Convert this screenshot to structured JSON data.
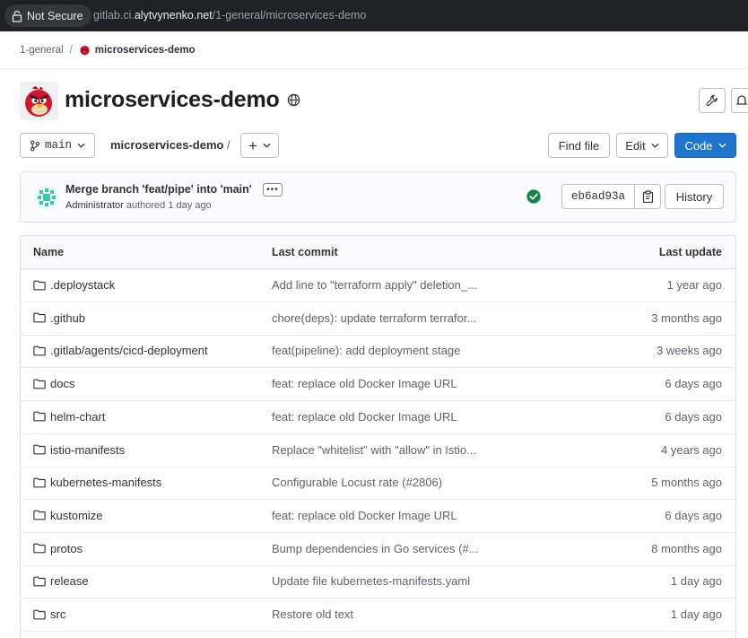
{
  "browser": {
    "security_label": "Not Secure",
    "url_prefix": "gitlab.ci.",
    "url_host": "alytvynenko.net",
    "url_path": "/1-general/microservices-demo"
  },
  "breadcrumb": {
    "group": "1-general",
    "separator": "/",
    "project": "microservices-demo"
  },
  "project": {
    "title": "microservices-demo",
    "visibility_icon": "globe-icon"
  },
  "toolbar": {
    "branch": "main",
    "path": "microservices-demo",
    "path_separator": "/",
    "add_label": "+",
    "find_file_label": "Find file",
    "edit_label": "Edit",
    "code_label": "Code"
  },
  "commit": {
    "title": "Merge branch 'feat/pipe' into 'main'",
    "author": "Administrator",
    "authored_text": "authored",
    "time": "1 day ago",
    "sha": "eb6ad93a",
    "history_label": "History",
    "ellipsis": "•••"
  },
  "table": {
    "headers": [
      "Name",
      "Last commit",
      "Last update"
    ],
    "rows": [
      {
        "name": ".deploystack",
        "commit": "Add line to \"terraform apply\" deletion_...",
        "updated": "1 year ago"
      },
      {
        "name": ".github",
        "commit": "chore(deps): update terraform terrafor...",
        "updated": "3 months ago"
      },
      {
        "name": ".gitlab/agents/cicd-deployment",
        "commit": "feat(pipeline): add deployment stage",
        "updated": "3 weeks ago"
      },
      {
        "name": "docs",
        "commit": "feat: replace old Docker Image URL",
        "updated": "6 days ago"
      },
      {
        "name": "helm-chart",
        "commit": "feat: replace old Docker Image URL",
        "updated": "6 days ago"
      },
      {
        "name": "istio-manifests",
        "commit": "Replace \"whitelist\" with \"allow\" in Istio...",
        "updated": "4 years ago"
      },
      {
        "name": "kubernetes-manifests",
        "commit": "Configurable Locust rate (#2806)",
        "updated": "5 months ago"
      },
      {
        "name": "kustomize",
        "commit": "feat: replace old Docker Image URL",
        "updated": "6 days ago"
      },
      {
        "name": "protos",
        "commit": "Bump dependencies in Go services (#...",
        "updated": "8 months ago"
      },
      {
        "name": "release",
        "commit": "Update file kubernetes-manifests.yaml",
        "updated": "1 day ago"
      },
      {
        "name": "src",
        "commit": "Restore old text",
        "updated": "1 day ago"
      }
    ]
  },
  "colors": {
    "accent": "#1f75cb",
    "success": "#108548",
    "url_bar": "#202124"
  }
}
